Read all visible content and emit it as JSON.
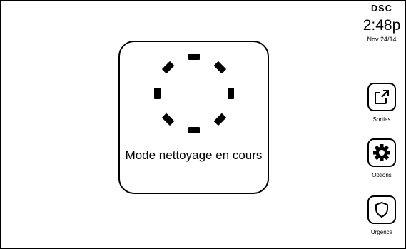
{
  "brand": "DSC",
  "clock": {
    "time": "2:48p",
    "date": "Nov 24/14"
  },
  "status": {
    "message": "Mode nettoyage en cours",
    "icon": "spinner-icon"
  },
  "sidebar": {
    "buttons": [
      {
        "label": "Sorties",
        "icon": "exit-icon"
      },
      {
        "label": "Options",
        "icon": "gear-icon"
      },
      {
        "label": "Urgence",
        "icon": "shield-icon"
      }
    ]
  },
  "colors": {
    "foreground": "#000000",
    "background": "#ffffff"
  }
}
